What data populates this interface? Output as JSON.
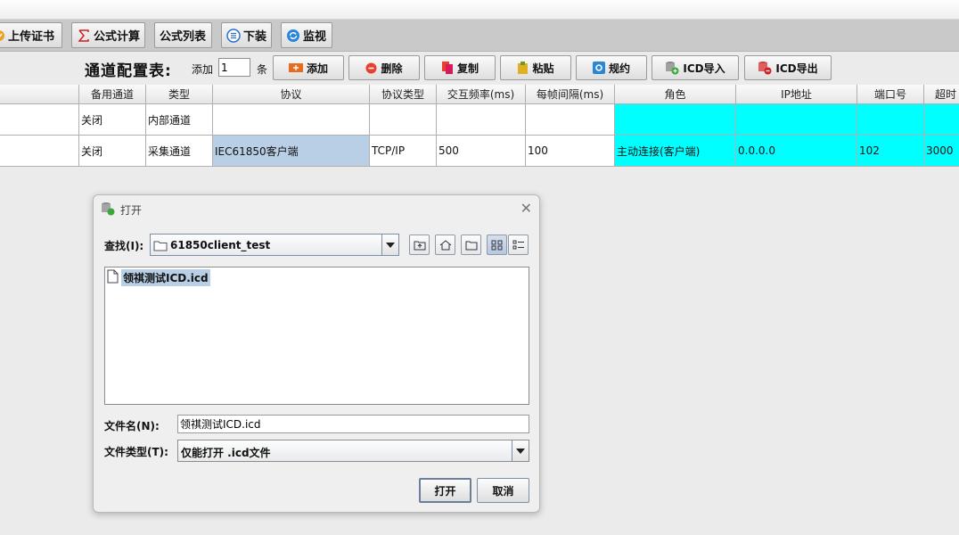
{
  "toolbar": {
    "upload_cert": "上传证书",
    "formula_calc": "公式计算",
    "formula_list": "公式列表",
    "download": "下装",
    "monitor": "监视"
  },
  "config": {
    "title": "通道配置表:",
    "add_label": "添加",
    "add_count": "1",
    "unit": "条",
    "buttons": {
      "add": "添加",
      "delete": "删除",
      "copy": "复制",
      "paste": "粘贴",
      "protocol": "规约",
      "icd_import": "ICD导入",
      "icd_export": "ICD导出"
    }
  },
  "table": {
    "headers": [
      "备用通道",
      "类型",
      "协议",
      "协议类型",
      "交互频率(ms)",
      "每帧间隔(ms)",
      "角色",
      "IP地址",
      "端口号",
      "超时"
    ],
    "rows": [
      [
        "关闭",
        "内部通道",
        "",
        "",
        "",
        "",
        "",
        "",
        "",
        ""
      ],
      [
        "关闭",
        "采集通道",
        "IEC61850客户端",
        "TCP/IP",
        "500",
        "100",
        "主动连接(客户端)",
        "0.0.0.0",
        "102",
        "3000"
      ]
    ]
  },
  "dialog": {
    "title": "打开",
    "lookin_label": "查找(I):",
    "lookin_value": "61850client_test",
    "files": [
      "领祺测试ICD.icd"
    ],
    "filename_label": "文件名(N):",
    "filename_value": "领祺测试ICD.icd",
    "filetype_label": "文件类型(T):",
    "filetype_value": "仅能打开 .icd文件",
    "open_button": "打开",
    "cancel_button": "取消"
  },
  "colors": {
    "toolbar_bg": "#c9c9c9",
    "cyan_cell": "#00ffff",
    "selected_cell": "#b8cfe5"
  }
}
